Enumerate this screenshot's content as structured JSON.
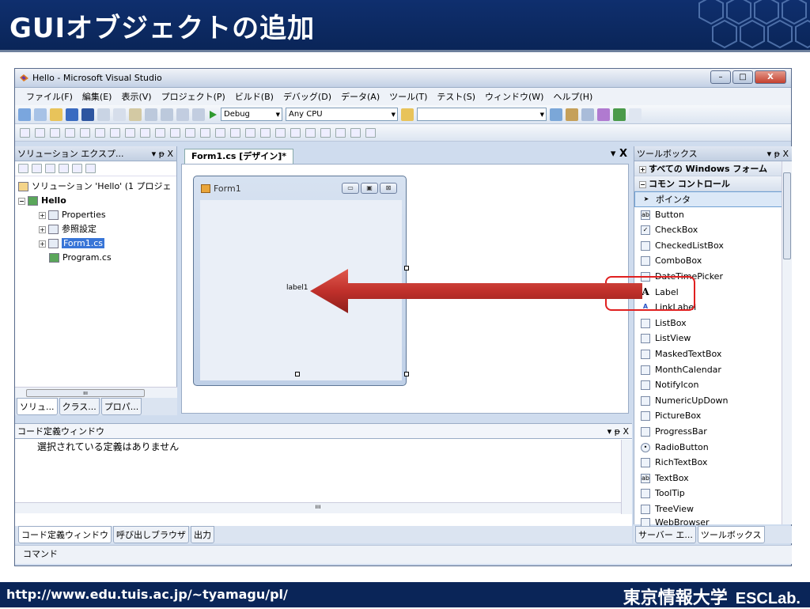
{
  "slide": {
    "title": "GUIオブジェクトの追加",
    "url": "http://www.edu.tuis.ac.jp/~tyamagu/pl/",
    "org": "東京情報大学",
    "lab": "ESCLab."
  },
  "window": {
    "title": "Hello - Microsoft Visual Studio",
    "minimize": "–",
    "maximize": "□",
    "close": "X"
  },
  "menu": [
    "ファイル(F)",
    "編集(E)",
    "表示(V)",
    "プロジェクト(P)",
    "ビルド(B)",
    "デバッグ(D)",
    "データ(A)",
    "ツール(T)",
    "テスト(S)",
    "ウィンドウ(W)",
    "ヘルプ(H)"
  ],
  "toolbar": {
    "config": "Debug",
    "platform": "Any CPU"
  },
  "solution_explorer": {
    "title": "ソリューション エクスプ...",
    "controls": "▾ ᵽ X",
    "items": [
      "ソリューション 'Hello' (1 プロジェ",
      "Hello",
      "Properties",
      "参照設定",
      "Form1.cs",
      "Program.cs"
    ],
    "tabs": [
      "ソリュ...",
      "クラス...",
      "プロパ..."
    ],
    "scroll_mark": "ııı"
  },
  "designer": {
    "tab": "Form1.cs [デザイン]*",
    "close": "▾ X",
    "form_title": "Form1",
    "label_text": "label1"
  },
  "code_definition": {
    "title": "コード定義ウィンドウ",
    "controls": "▾ ᵽ X",
    "message": "選択されている定義はありません",
    "scroll_mark": "ııı",
    "tabs": [
      "コード定義ウィンドウ",
      "呼び出しブラウザ",
      "出力"
    ]
  },
  "command_bar": "コマンド",
  "toolbox": {
    "title": "ツールボックス",
    "controls": "▾ ᵽ X",
    "categories": [
      "すべての Windows フォーム",
      "コモン コントロール"
    ],
    "items": [
      "ポインタ",
      "Button",
      "CheckBox",
      "CheckedListBox",
      "ComboBox",
      "DateTimePicker",
      "Label",
      "LinkLabel",
      "ListBox",
      "ListView",
      "MaskedTextBox",
      "MonthCalendar",
      "NotifyIcon",
      "NumericUpDown",
      "PictureBox",
      "ProgressBar",
      "RadioButton",
      "RichTextBox",
      "TextBox",
      "ToolTip",
      "TreeView",
      "WebBrowser"
    ],
    "tabs": [
      "サーバー エ...",
      "ツールボックス"
    ]
  },
  "colors": {
    "header": "#0f2f6e",
    "highlight_box": "#e02020",
    "arrow": "#c0302b",
    "selection": "#3875d7"
  }
}
